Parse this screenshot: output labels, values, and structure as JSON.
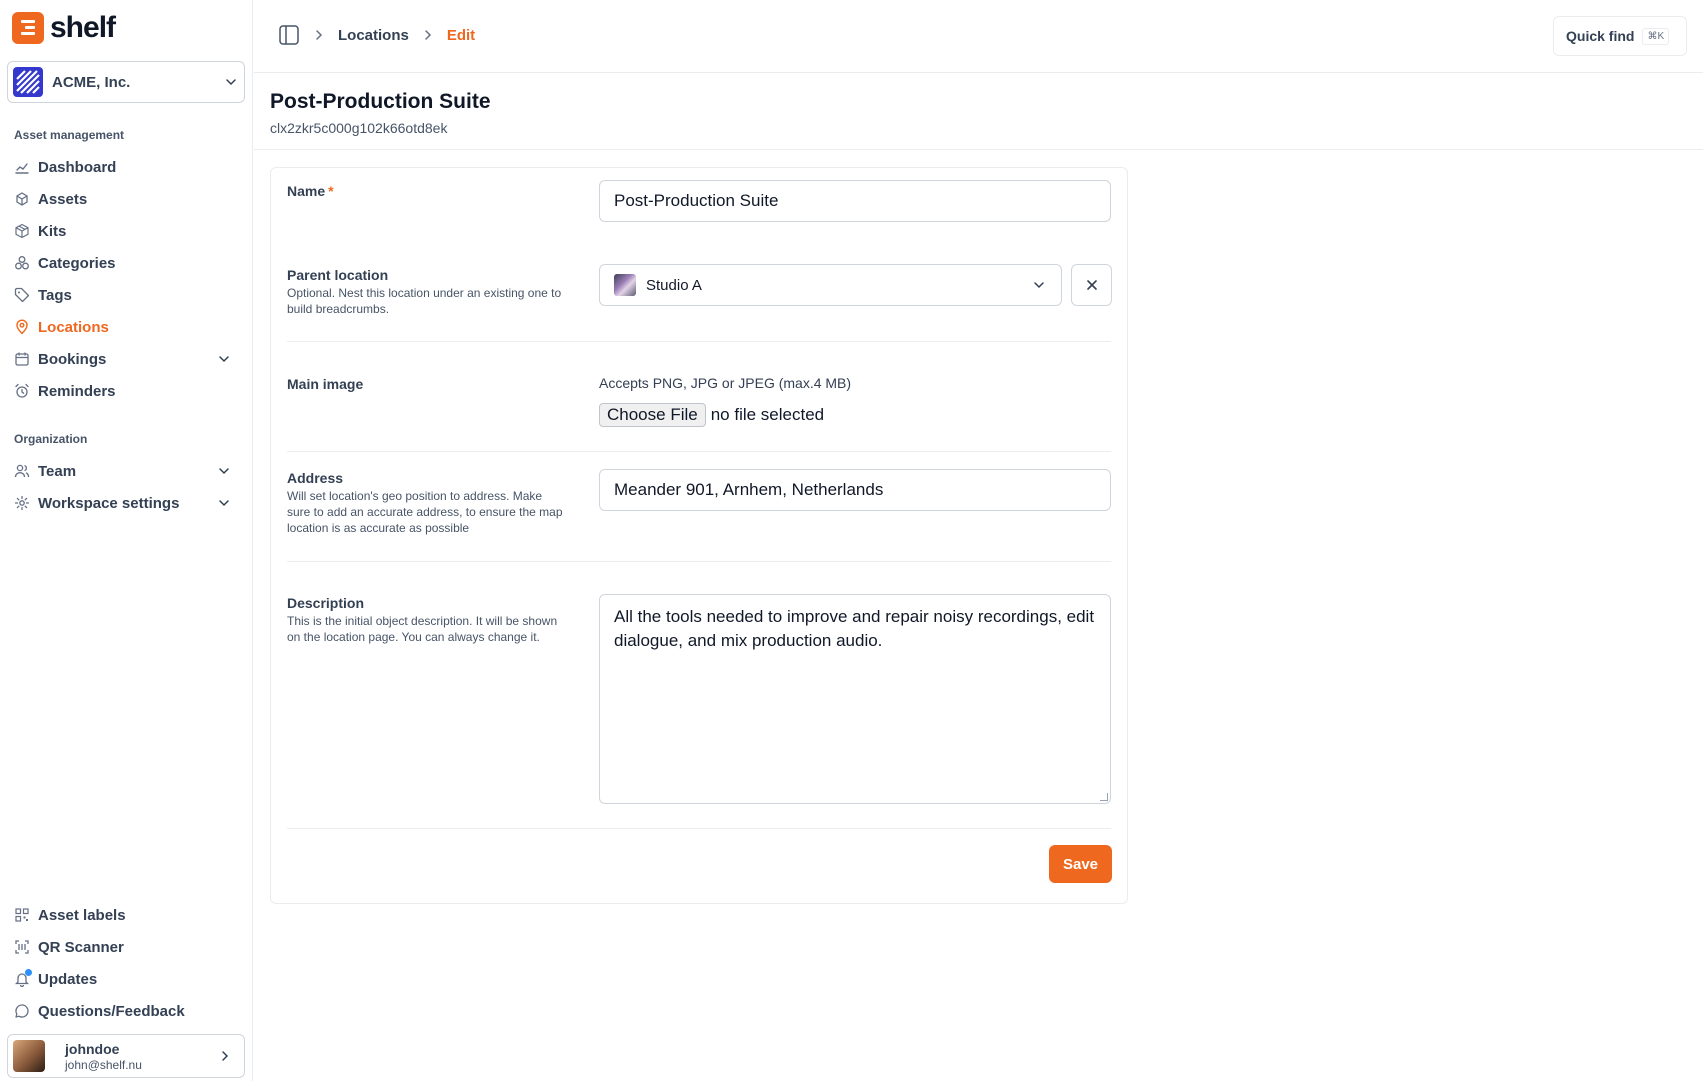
{
  "app": {
    "logo_text": "shelf"
  },
  "workspace": {
    "name": "ACME, Inc."
  },
  "sidebar": {
    "section_asset": "Asset management",
    "asset_items": [
      {
        "label": "Dashboard",
        "icon": "chart-icon"
      },
      {
        "label": "Assets",
        "icon": "cubes-icon"
      },
      {
        "label": "Kits",
        "icon": "box-icon"
      },
      {
        "label": "Categories",
        "icon": "categories-icon"
      },
      {
        "label": "Tags",
        "icon": "tag-icon"
      },
      {
        "label": "Locations",
        "icon": "location-pin-icon",
        "active": true
      },
      {
        "label": "Bookings",
        "icon": "calendar-icon",
        "expandable": true
      },
      {
        "label": "Reminders",
        "icon": "alarm-icon"
      }
    ],
    "section_org": "Organization",
    "org_items": [
      {
        "label": "Team",
        "icon": "users-icon",
        "expandable": true
      },
      {
        "label": "Workspace settings",
        "icon": "gear-icon",
        "expandable": true
      }
    ],
    "bottom_items": [
      {
        "label": "Asset labels",
        "icon": "qr-icon"
      },
      {
        "label": "QR Scanner",
        "icon": "scan-icon"
      },
      {
        "label": "Updates",
        "icon": "bell-icon"
      },
      {
        "label": "Questions/Feedback",
        "icon": "chat-icon"
      }
    ]
  },
  "user": {
    "name": "johndoe",
    "email": "john@shelf.nu"
  },
  "header": {
    "breadcrumb": [
      "Locations",
      "Edit"
    ],
    "quick_find": "Quick find",
    "quick_find_kbd": "⌘K"
  },
  "page": {
    "title": "Post-Production Suite",
    "id": "clx2zkr5c000g102k66otd8ek"
  },
  "form": {
    "name_label": "Name",
    "name_required": "*",
    "name_value": "Post-Production Suite",
    "parent_label": "Parent location",
    "parent_help": "Optional. Nest this location under an existing one to build breadcrumbs.",
    "parent_value": "Studio A",
    "image_label": "Main image",
    "image_accepts": "Accepts PNG, JPG or JPEG (max.4 MB)",
    "image_choose": "Choose File",
    "image_status": "no file selected",
    "address_label": "Address",
    "address_help": "Will set location's geo position to address. Make sure to add an accurate address, to ensure the map location is as accurate as possible",
    "address_value": "Meander 901, Arnhem, Netherlands",
    "description_label": "Description",
    "description_help": "This is the initial object description. It will be shown on the location page. You can always change it.",
    "description_value": "All the tools needed to improve and repair noisy recordings, edit dialogue, and mix production audio.",
    "save_label": "Save"
  },
  "colors": {
    "accent": "#ef6820",
    "workspace": "#3538cd",
    "update_dot": "#2e90fa"
  }
}
